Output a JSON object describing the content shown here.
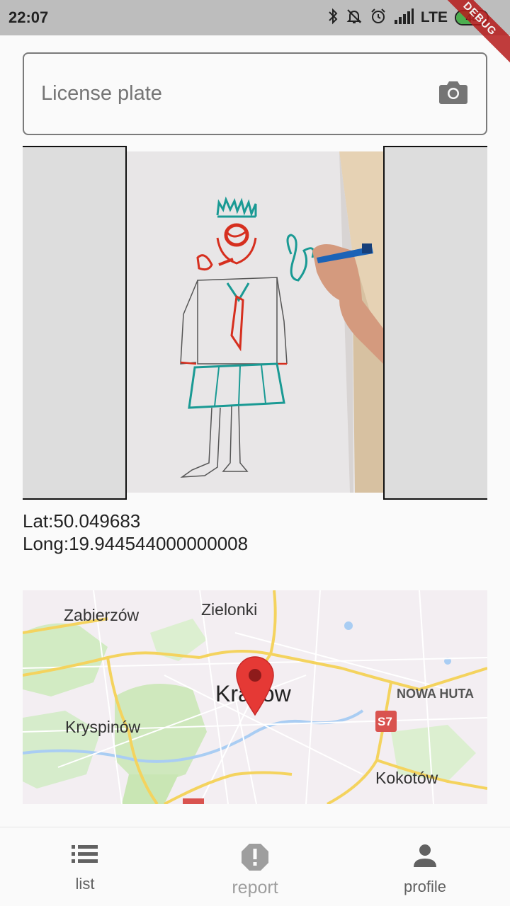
{
  "status_bar": {
    "time": "22:07",
    "network": "LTE",
    "battery_level": "48",
    "battery_fraction": 0.48,
    "icons": [
      "bluetooth-icon",
      "notifications-off-icon",
      "alarm-icon",
      "signal-icon"
    ],
    "debug_banner": "DEBUG"
  },
  "plate_field": {
    "placeholder": "License plate",
    "value": "",
    "action_icon": "camera-icon"
  },
  "photo": {
    "description_icon": "report-photo"
  },
  "location": {
    "lat": "Lat:50.049683",
    "long": "Long:19.944544000000008"
  },
  "map": {
    "labels": {
      "zabierzow": "Zabierzów",
      "zielonki": "Zielonki",
      "krakow": "Kraków",
      "nowa_huta": "NOWA HUTA",
      "kryspinow": "Kryspinów",
      "kokotow": "Kokotów",
      "road_badge": "S7"
    },
    "marker_color": "#e53935"
  },
  "bottom_nav": {
    "items": [
      {
        "label": "list",
        "icon": "list-icon"
      },
      {
        "label": "report",
        "icon": "report-icon"
      },
      {
        "label": "profile",
        "icon": "person-icon"
      }
    ],
    "active": "report"
  }
}
